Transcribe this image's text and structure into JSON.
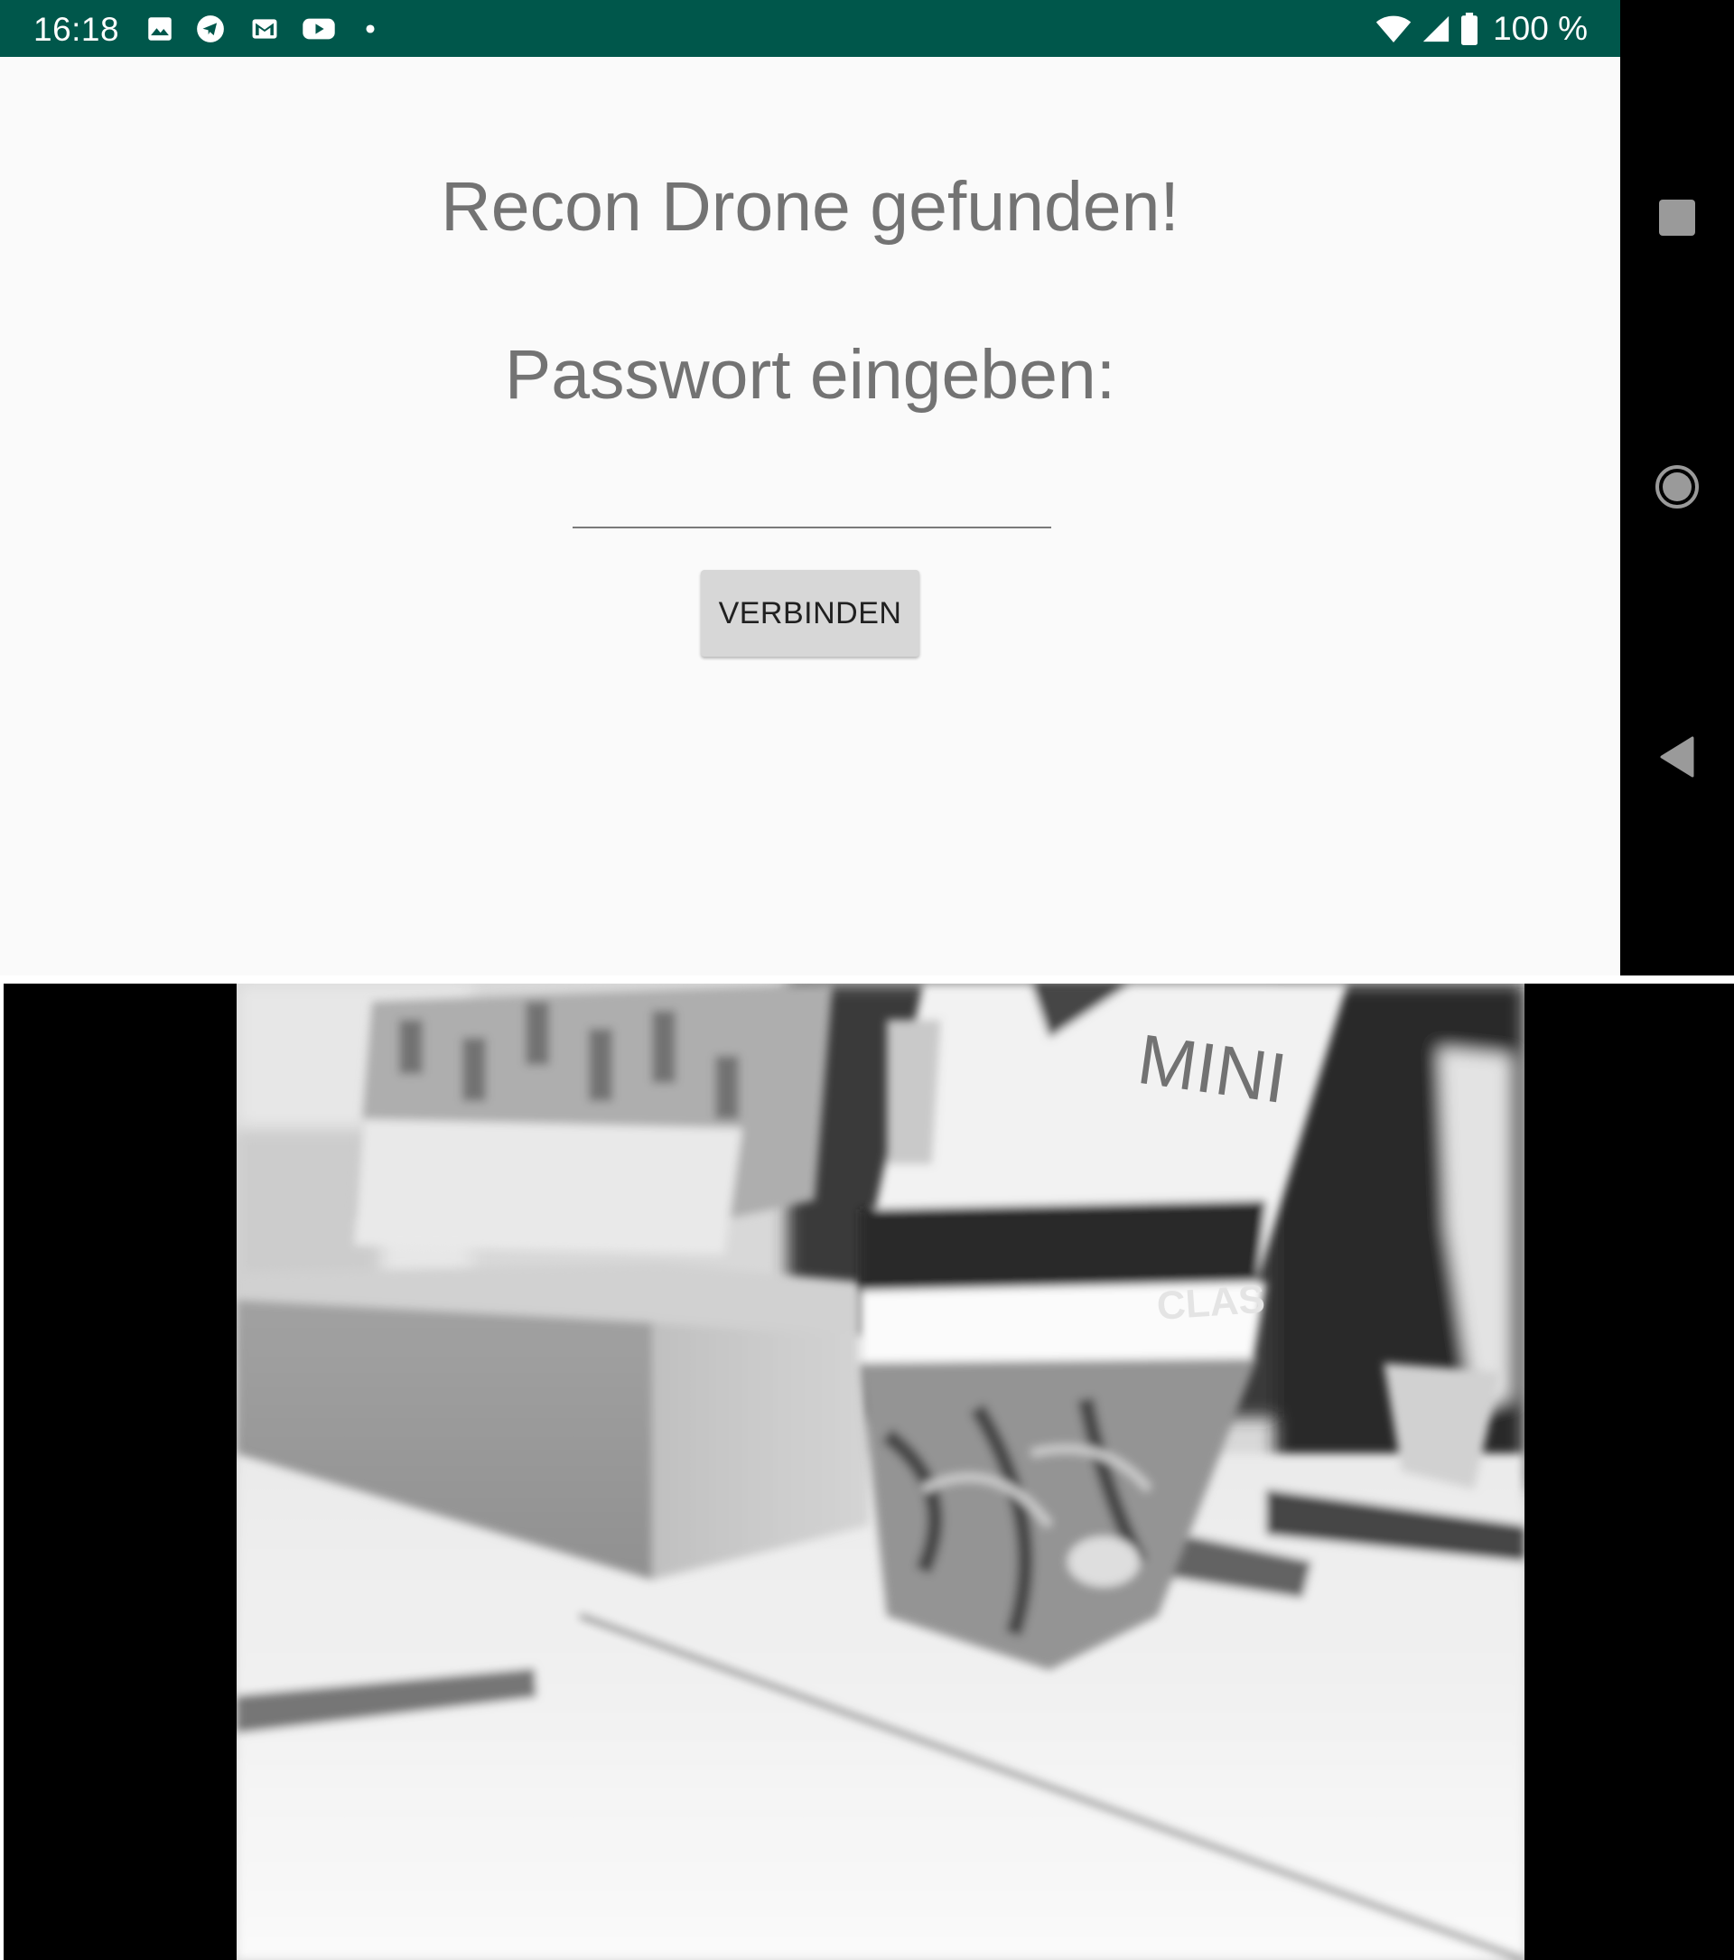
{
  "status_bar": {
    "time": "16:18",
    "notification_icons": [
      "image-icon",
      "telegram-icon",
      "gmail-icon",
      "youtube-icon",
      "more-dot-icon"
    ],
    "system_icons": [
      "wifi-icon",
      "cell-signal-icon",
      "battery-icon"
    ],
    "battery_text": "100 %",
    "background_color": "#00574b"
  },
  "main": {
    "found_text": "Recon Drone gefunden!",
    "password_label": "Passwort eingeben:",
    "password_value": "",
    "connect_label": "VERBINDEN"
  },
  "nav_bar": {
    "buttons": [
      "recents-icon",
      "home-icon",
      "back-icon"
    ]
  },
  "camera_frame": {
    "visible_text": [
      "MINI",
      "CLAS"
    ]
  }
}
